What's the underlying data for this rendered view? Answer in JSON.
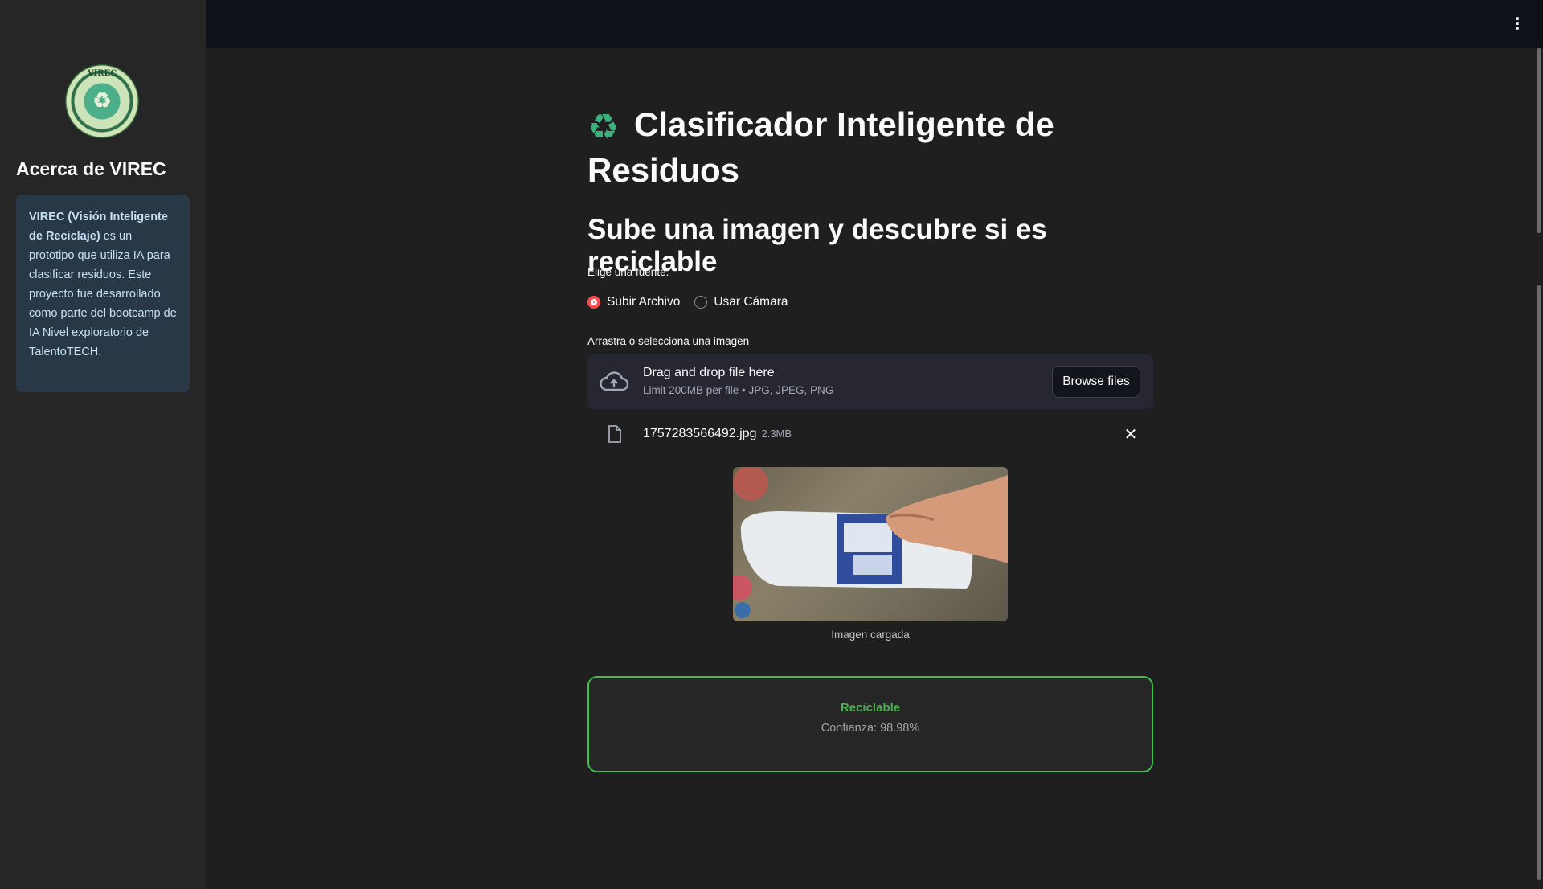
{
  "sidebar": {
    "logo_text": "VIREC",
    "title": "Acerca de VIREC",
    "info_bold": "VIREC (Visión Inteligente de Reciclaje)",
    "info_rest": " es un prototipo que utiliza IA para clasificar residuos. Este proyecto fue desarrollado como parte del bootcamp de IA Nivel exploratorio de TalentoTECH."
  },
  "header": {
    "menu_icon": "kebab-menu-icon"
  },
  "main": {
    "title": "Clasificador Inteligente de Residuos",
    "title_icon": "recycle-icon",
    "subtitle": "Sube una imagen y descubre si es reciclable",
    "source_label": "Elige una fuente:",
    "source_options": [
      {
        "label": "Subir Archivo",
        "selected": true
      },
      {
        "label": "Usar Cámara",
        "selected": false
      }
    ],
    "uploader_label": "Arrastra o selecciona una imagen",
    "dropzone_title": "Drag and drop file here",
    "dropzone_sub": "Limit 200MB per file • JPG, JPEG, PNG",
    "browse_label": "Browse files",
    "file_name": "1757283566492.jpg",
    "file_size": "2.3MB",
    "image_caption": "Imagen cargada",
    "result_label": "Reciclable",
    "result_confidence": "Confianza: 98.98%",
    "accent_color": "#ff4b4b",
    "result_color": "#4caf50"
  }
}
